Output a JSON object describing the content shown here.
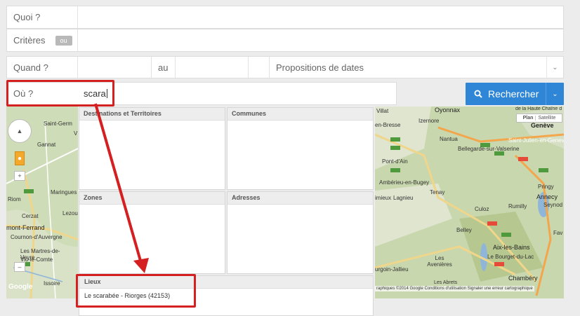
{
  "form": {
    "quoi_label": "Quoi ?",
    "criteres_label": "Critères",
    "ou_badge": "ou",
    "quand_label": "Quand ?",
    "au_label": "au",
    "propositions_label": "Propositions de dates",
    "ou_label": "Où ?",
    "ou_value": "scara"
  },
  "search_button": {
    "label": "Rechercher"
  },
  "dropdown": {
    "sections": {
      "destinations": "Destinations et Territoires",
      "communes": "Communes",
      "zones": "Zones",
      "adresses": "Adresses",
      "lieux": "Lieux"
    },
    "lieux_items": [
      "Le scarabée - Riorges (42153)"
    ]
  },
  "left_map": {
    "labels": [
      "Saint-Germ",
      "Gannat",
      "Riom",
      "Maringues",
      "Cerzat",
      "Lezou",
      "mont-Ferrand",
      "Cournon-d'Auvergne",
      "Les Martres-de-Veyre",
      "Vic-le-Comte",
      "Issoire",
      "V"
    ],
    "google": "Google"
  },
  "right_map": {
    "labels": [
      "Villat",
      "Oyonnax",
      "de la Haute Chaîne d",
      "en-Bresse",
      "Izernore",
      "Genève",
      "Nantua",
      "Saint-Julien-en-Genevois",
      "Bellegarde-sur-Valserine",
      "Pont-d'Ain",
      "Ambérieu-en-Bugey",
      "Tenay",
      "imieux",
      "Lagnieu",
      "Pringy",
      "Annecy",
      "Seynod",
      "Rumilly",
      "Culoz",
      "Belley",
      "Aix-les-Bains",
      "Le Bourget-du-Lac",
      "Les Avenières",
      "urgoin-Jallieu",
      "Chambéry",
      "Les Abrets",
      "Fav"
    ],
    "plan": "Plan",
    "satellite": "Satellite",
    "footer": "raphiques ©2014 Google   Conditions d'utilisation   Signaler une erreur cartographique"
  }
}
